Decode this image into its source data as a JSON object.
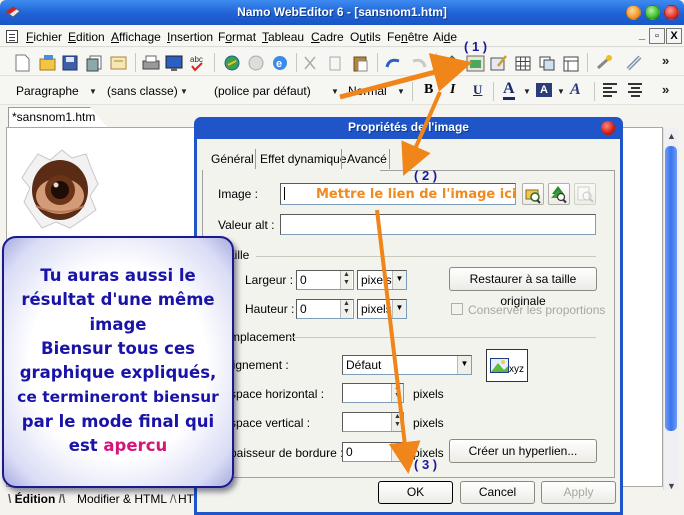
{
  "window": {
    "title": "Namo WebEditor 6 - [sansnom1.htm]",
    "controls": [
      "minimize",
      "maximize",
      "close"
    ]
  },
  "menubar": {
    "items": [
      {
        "label": "Fichier",
        "mnemonic": "F"
      },
      {
        "label": "Edition",
        "mnemonic": "E"
      },
      {
        "label": "Affichage",
        "mnemonic": "A"
      },
      {
        "label": "Insertion",
        "mnemonic": "I"
      },
      {
        "label": "Format",
        "mnemonic": "o"
      },
      {
        "label": "Tableau",
        "mnemonic": "T"
      },
      {
        "label": "Cadre",
        "mnemonic": "C"
      },
      {
        "label": "Outils",
        "mnemonic": "u"
      },
      {
        "label": "Fenêtre",
        "mnemonic": "n"
      },
      {
        "label": "Aide",
        "mnemonic": "d"
      }
    ],
    "mdi_controls": [
      "_",
      "🗗",
      "X"
    ]
  },
  "toolbar1": {
    "icons": [
      "new-document-icon",
      "open-folder-icon",
      "save-icon",
      "save-all-icon",
      "template-icon",
      "print-icon",
      "preview-icon",
      "spellcheck-icon",
      "publish-icon",
      "site-icon",
      "browser-preview-icon",
      "cut-icon",
      "copy-icon",
      "paste-icon",
      "undo-icon",
      "redo-icon",
      "insert-shape-icon",
      "insert-image-icon",
      "edit-icon",
      "insert-table-icon",
      "layer-icon",
      "frame-icon",
      "wizard-icon",
      "hyperlink-icon"
    ],
    "overflow": "»"
  },
  "toolbar2": {
    "paragraph_style": "Paragraphe",
    "class": "(sans classe)",
    "font": "(police par défaut)",
    "size": "Normal",
    "bold": "B",
    "italic": "I",
    "underline": "U",
    "font_color": "A",
    "highlight": "A",
    "overflow": "»"
  },
  "document": {
    "tab_label": "*sansnom1.htm",
    "bottom_tabs": [
      "Édition",
      "Modifier & HTML",
      "HTML"
    ]
  },
  "dialog": {
    "title": "Propriétés de l'image",
    "tabs": [
      "Général",
      "Effet dynamique",
      "Avancé"
    ],
    "active_tab": "Général",
    "image_label": "Image :",
    "image_value": "",
    "alt_label": "Valeur alt :",
    "alt_value": "",
    "size_group": "Taille",
    "width_label": "Largeur :",
    "width_value": "0",
    "width_unit": "pixels",
    "height_label": "Hauteur :",
    "height_value": "0",
    "height_unit": "pixels",
    "restore_button": "Restaurer à sa taille originale",
    "keep_ratio_label": "Conserver les proportions",
    "keep_ratio_checked": false,
    "placement_group": "Emplacement",
    "align_label": "Alignement :",
    "align_value": "Défaut",
    "hspace_label": "Espace horizontal :",
    "hspace_value": "",
    "hspace_unit": "pixels",
    "vspace_label": "Espace vertical :",
    "vspace_value": "",
    "vspace_unit": "pixels",
    "border_label": "Epaisseur de bordure :",
    "border_value": "0",
    "border_unit": "pixels",
    "hyperlink_button": "Créer un hyperlien...",
    "preview_text": "xyz",
    "ok": "OK",
    "cancel": "Cancel",
    "apply": "Apply"
  },
  "annotations": {
    "step1": "( 1 )",
    "step2": "( 2 )",
    "step3": "( 3 )",
    "image_hint": "Mettre le lien de l'image ici",
    "arrow_color": "#f0851a",
    "callout_lines": [
      "Tu auras aussi le",
      "résultat d'une même",
      "image",
      "Biensur tous ces",
      "graphique expliqués,",
      "ce termineront biensur",
      "par le mode final qui"
    ],
    "callout_last_prefix": "est ",
    "callout_highlight": "apercu",
    "callout_text_color": "#1a13a8",
    "callout_highlight_color": "#d6157a"
  }
}
